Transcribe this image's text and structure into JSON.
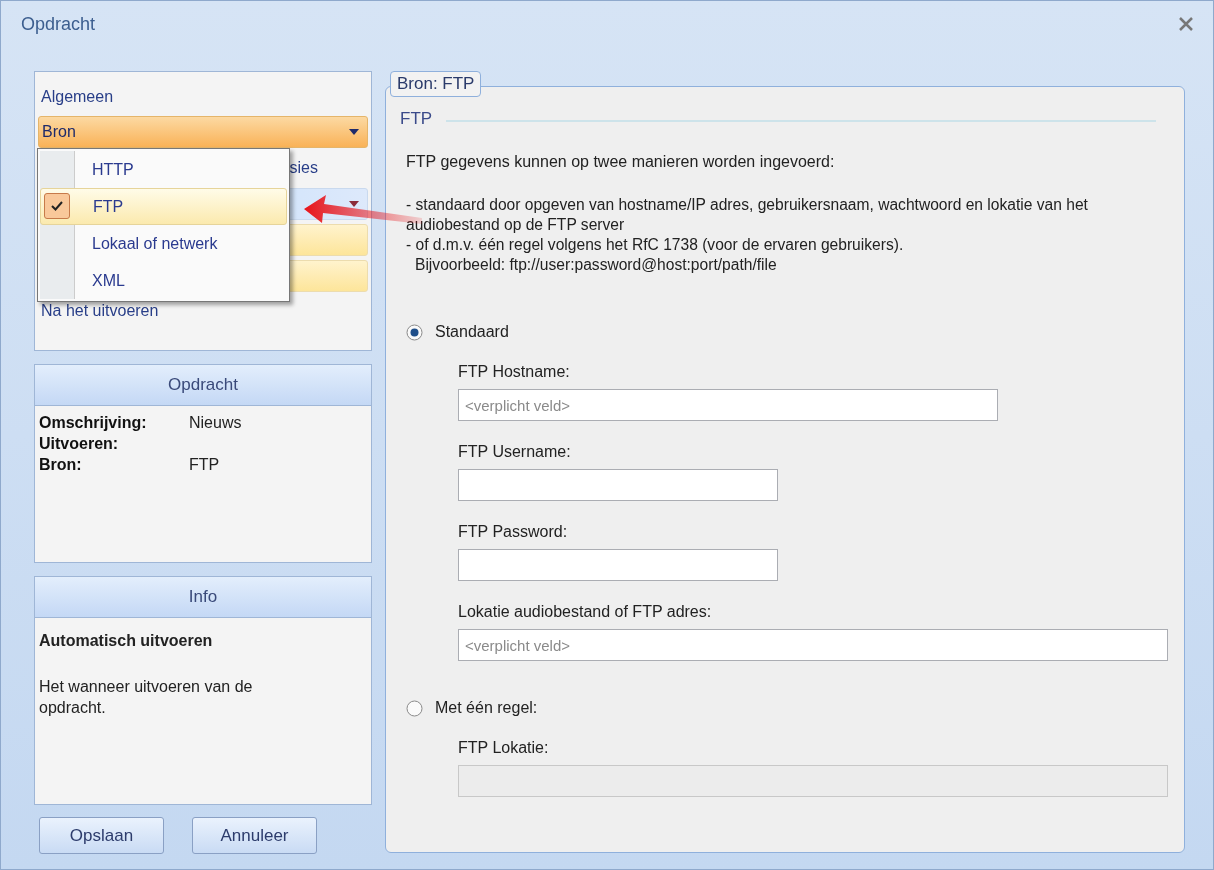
{
  "window": {
    "title": "Opdracht"
  },
  "nav": [
    {
      "kind": "link",
      "label": "Algemeen"
    },
    {
      "kind": "combo",
      "label": "Bron",
      "open": true
    },
    {
      "kind": "covered-link",
      "tail": "sies"
    },
    {
      "kind": "covered-bar",
      "selected": true
    },
    {
      "kind": "covered-bar",
      "selected": false
    },
    {
      "kind": "covered-bar",
      "selected": false
    },
    {
      "kind": "link",
      "label": "Na het uitvoeren"
    }
  ],
  "source_menu": [
    {
      "label": "HTTP",
      "checked": false
    },
    {
      "label": "FTP",
      "checked": true
    },
    {
      "label": "Lokaal of netwerk",
      "checked": false
    },
    {
      "label": "XML",
      "checked": false
    }
  ],
  "summary": {
    "header": "Opdracht",
    "rows": [
      {
        "label": "Omschrijving:",
        "value": "Nieuws"
      },
      {
        "label": "Uitvoeren:"
      },
      {
        "label": "Bron:",
        "value": "FTP"
      }
    ]
  },
  "info": {
    "header": "Info",
    "title": "Automatisch uitvoeren",
    "text": "Het wanneer uitvoeren van de opdracht."
  },
  "buttons": [
    "Opslaan",
    "Annuleer"
  ],
  "panel": {
    "tab": "Bron: FTP",
    "section": "FTP",
    "intro": "FTP gegevens kunnen op twee manieren worden ingevoerd:",
    "lines": [
      "- standaard door opgeven van hostname/IP adres, gebruikersnaam, wachtwoord en lokatie van het audiobestand op de FTP server",
      "- of d.m.v. één regel volgens het RfC 1738 (voor de ervaren gebruikers).",
      "Bijvoorbeeld:  ftp://user:password@host:port/path/file"
    ],
    "options": [
      {
        "label": "Standaard",
        "selected": true,
        "fields": [
          {
            "label": "FTP Hostname:",
            "placeholder": "<verplicht veld>",
            "disabled": false
          },
          {
            "label": "FTP Username:",
            "disabled": false
          },
          {
            "label": "FTP Password:",
            "disabled": false
          },
          {
            "label": "Lokatie audiobestand of FTP adres:",
            "placeholder": "<verplicht veld>",
            "disabled": false
          }
        ]
      },
      {
        "label": "Met één regel:",
        "selected": false,
        "fields": [
          {
            "label": "FTP Lokatie:",
            "disabled": true
          }
        ]
      }
    ]
  }
}
